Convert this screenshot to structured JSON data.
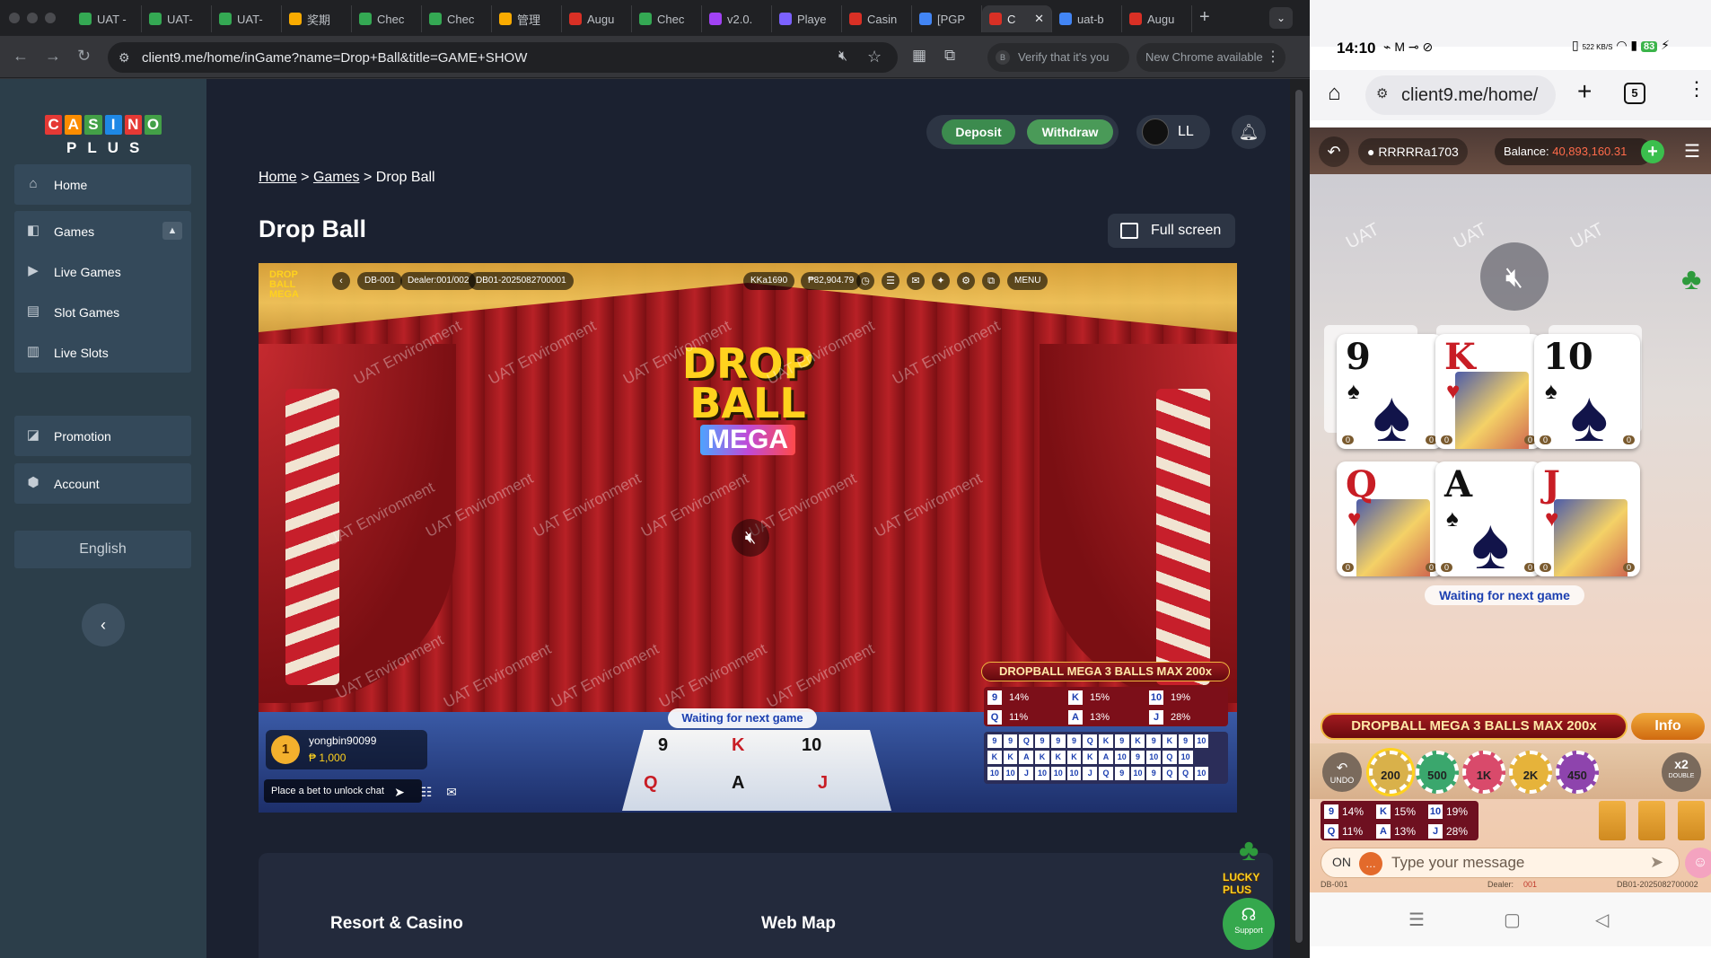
{
  "browser": {
    "tabs": [
      {
        "label": "UAT -",
        "color": "#34a853"
      },
      {
        "label": "UAT-",
        "color": "#34a853"
      },
      {
        "label": "UAT-",
        "color": "#34a853"
      },
      {
        "label": "奖期",
        "color": "#f9ab00"
      },
      {
        "label": "Chec",
        "color": "#34a853"
      },
      {
        "label": "Chec",
        "color": "#34a853"
      },
      {
        "label": "管理",
        "color": "#f9ab00"
      },
      {
        "label": "Augu",
        "color": "#d93025"
      },
      {
        "label": "Chec",
        "color": "#34a853"
      },
      {
        "label": "v2.0.",
        "color": "#a142f4"
      },
      {
        "label": "Playe",
        "color": "#7b61ff"
      },
      {
        "label": "Casin",
        "color": "#d93025"
      },
      {
        "label": "[PGP",
        "color": "#4285f4"
      },
      {
        "label": "C",
        "color": "#d93025"
      },
      {
        "label": "uat-b",
        "color": "#4285f4"
      },
      {
        "label": "Augu",
        "color": "#d93025"
      }
    ],
    "active_tab_index": 13,
    "url": "client9.me/home/inGame?name=Drop+Ball&title=GAME+SHOW",
    "verify_label": "Verify that it's you",
    "verify_badge": "B",
    "new_chrome_label": "New Chrome available"
  },
  "site": {
    "logo_letters": [
      "C",
      "A",
      "S",
      "I",
      "N",
      "O"
    ],
    "logo_colors": [
      "#e53935",
      "#fb8c00",
      "#43a047",
      "#1e88e5",
      "#e53935",
      "#43a047"
    ],
    "logo_sub": "PLUS",
    "nav": [
      {
        "label": "Home",
        "icon": "home-icon"
      },
      {
        "label": "Games",
        "icon": "games-icon",
        "expanded": true
      },
      {
        "label": "Live Games",
        "icon": "live-games-icon"
      },
      {
        "label": "Slot Games",
        "icon": "slot-icon"
      },
      {
        "label": "Live Slots",
        "icon": "live-slots-icon"
      },
      {
        "label": "Promotion",
        "icon": "promotion-icon"
      },
      {
        "label": "Account",
        "icon": "account-icon"
      }
    ],
    "language": "English",
    "deposit_label": "Deposit",
    "withdraw_label": "Withdraw",
    "username": "LL",
    "breadcrumb": [
      "Home",
      "Games",
      "Drop Ball"
    ],
    "breadcrumb_sep": ">",
    "page_title": "Drop Ball",
    "fullscreen_label": "Full screen",
    "footer_sections": [
      "Resort & Casino",
      "Web Map"
    ],
    "support_label": "Support",
    "lucky_label": "LUCKY PLUS"
  },
  "game": {
    "brand": "DROP BALL MEGA",
    "logo_line1": "DROP",
    "logo_line2": "BALL",
    "logo_line3": "MEGA",
    "table_id": "DB-001",
    "dealer": "Dealer:001/002",
    "round_id": "DB01-2025082700001",
    "player": "KKa1690",
    "player_balance": "₱82,904.79",
    "menu_label": "MENU",
    "watermark": "UAT Environment",
    "waiting": "Waiting for next game",
    "top_user": "yongbin90099",
    "top_user_amount": "₱ 1,000",
    "top_user_rank": "1",
    "chat_placeholder": "Place a bet to unlock chat",
    "promo": "DROPBALL MEGA 3 BALLS MAX 200x",
    "odds": [
      {
        "card": "9",
        "pct": "14%"
      },
      {
        "card": "K",
        "pct": "15%"
      },
      {
        "card": "10",
        "pct": "19%"
      },
      {
        "card": "Q",
        "pct": "11%"
      },
      {
        "card": "A",
        "pct": "13%"
      },
      {
        "card": "J",
        "pct": "28%"
      }
    ],
    "history": [
      "9",
      "9",
      "Q",
      "9",
      "9",
      "9",
      "Q",
      "K",
      "9",
      "K",
      "9",
      "K",
      "9",
      "10",
      "",
      "K",
      "K",
      "A",
      "K",
      "K",
      "K",
      "K",
      "A",
      "10",
      "9",
      "10",
      "Q",
      "10",
      "",
      "",
      "10",
      "10",
      "J",
      "10",
      "10",
      "10",
      "J",
      "Q",
      "9",
      "10",
      "9",
      "Q",
      "Q",
      "10",
      ""
    ]
  },
  "phone": {
    "time": "14:10",
    "status_icons": "⌁ M ⊸ ⊘",
    "net_speed": "522 KB/S",
    "battery": "83",
    "url": "client9.me/home/",
    "tab_count": "5",
    "username": "RRRRRa1703",
    "balance_label": "Balance:",
    "balance_value": "40,893,160.31",
    "watermark": "UAT",
    "waiting": "Waiting for next game",
    "cards": [
      {
        "rank": "9",
        "suit": "♠",
        "color": "black",
        "face": false
      },
      {
        "rank": "K",
        "suit": "♥",
        "color": "red",
        "face": true
      },
      {
        "rank": "10",
        "suit": "♠",
        "color": "black",
        "face": false
      },
      {
        "rank": "Q",
        "suit": "♥",
        "color": "red",
        "face": true
      },
      {
        "rank": "A",
        "suit": "♠",
        "color": "black",
        "face": false
      },
      {
        "rank": "J",
        "suit": "♥",
        "color": "red",
        "face": true
      }
    ],
    "card_counts": "0",
    "promo": "DROPBALL MEGA 3 BALLS MAX 200x",
    "info_label": "Info",
    "undo_label": "UNDO",
    "chips": [
      "200",
      "500",
      "1K",
      "2K",
      "450"
    ],
    "chip_colors": [
      "#d9b14a",
      "#3aa76d",
      "#d94a6b",
      "#e6b33a",
      "#8e44ad"
    ],
    "double_label": "x2",
    "double_sub": "DOUBLE",
    "odds": [
      {
        "card": "9",
        "pct": "14%"
      },
      {
        "card": "K",
        "pct": "15%"
      },
      {
        "card": "10",
        "pct": "19%"
      },
      {
        "card": "Q",
        "pct": "11%"
      },
      {
        "card": "A",
        "pct": "13%"
      },
      {
        "card": "J",
        "pct": "28%"
      }
    ],
    "chat_on": "ON",
    "chat_placeholder": "Type your message",
    "footer_table": "DB-001",
    "footer_dealer_label": "Dealer:",
    "footer_dealer_value": "001",
    "footer_round": "DB01-2025082700002"
  }
}
